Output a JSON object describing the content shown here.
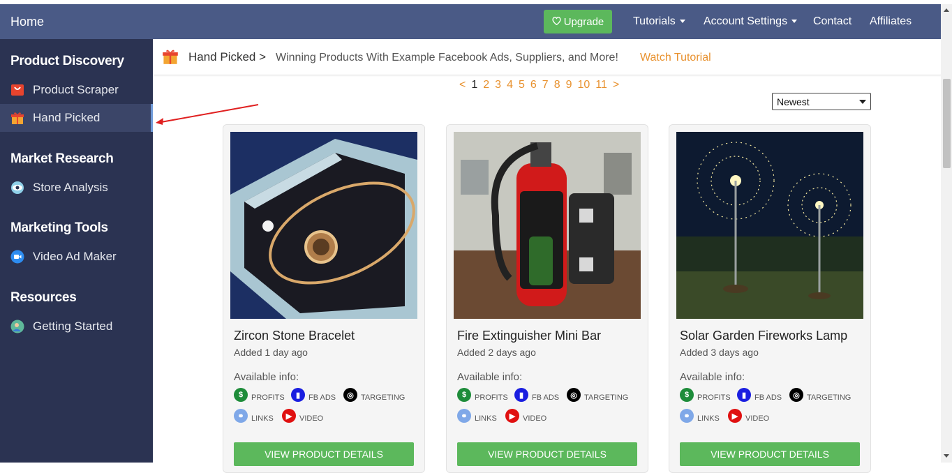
{
  "navbar": {
    "home": "Home",
    "upgrade": "Upgrade",
    "items": [
      {
        "label": "Tutorials",
        "dropdown": true
      },
      {
        "label": "Account Settings",
        "dropdown": true
      },
      {
        "label": "Contact",
        "dropdown": false
      },
      {
        "label": "Affiliates",
        "dropdown": false
      }
    ]
  },
  "sidebar": {
    "sections": [
      {
        "title": "Product Discovery",
        "items": [
          {
            "label": "Product Scraper",
            "icon": "shopping-bag-icon"
          },
          {
            "label": "Hand Picked",
            "icon": "gift-icon",
            "active": true
          }
        ]
      },
      {
        "title": "Market Research",
        "items": [
          {
            "label": "Store Analysis",
            "icon": "eye-icon"
          }
        ]
      },
      {
        "title": "Marketing Tools",
        "items": [
          {
            "label": "Video Ad Maker",
            "icon": "video-camera-icon"
          }
        ]
      },
      {
        "title": "Resources",
        "items": [
          {
            "label": "Getting Started",
            "icon": "user-globe-icon"
          }
        ]
      }
    ]
  },
  "header": {
    "breadcrumb": "Hand Picked >",
    "subtitle": "Winning Products With Example Facebook Ads, Suppliers, and More!",
    "tutorial_link": "Watch Tutorial"
  },
  "pagination": {
    "prev": "<",
    "pages": [
      "1",
      "2",
      "3",
      "4",
      "5",
      "6",
      "7",
      "8",
      "9",
      "10",
      "11"
    ],
    "current": "1",
    "next": ">"
  },
  "sort": {
    "selected": "Newest"
  },
  "products": [
    {
      "title": "Zircon Stone Bracelet",
      "added": "Added 1 day ago"
    },
    {
      "title": "Fire Extinguisher Mini Bar",
      "added": "Added 2 days ago"
    },
    {
      "title": "Solar Garden Fireworks Lamp",
      "added": "Added 3 days ago"
    }
  ],
  "card_labels": {
    "available": "Available info:",
    "profits": "PROFITS",
    "fb_ads": "FB ADS",
    "targeting": "TARGETING",
    "links": "LINKS",
    "video": "VIDEO",
    "button": "VIEW PRODUCT DETAILS"
  },
  "colors": {
    "navbar": "#4a5a86",
    "sidebar": "#2b3352",
    "accent_orange": "#e8912e",
    "button_green": "#5cb85c"
  }
}
